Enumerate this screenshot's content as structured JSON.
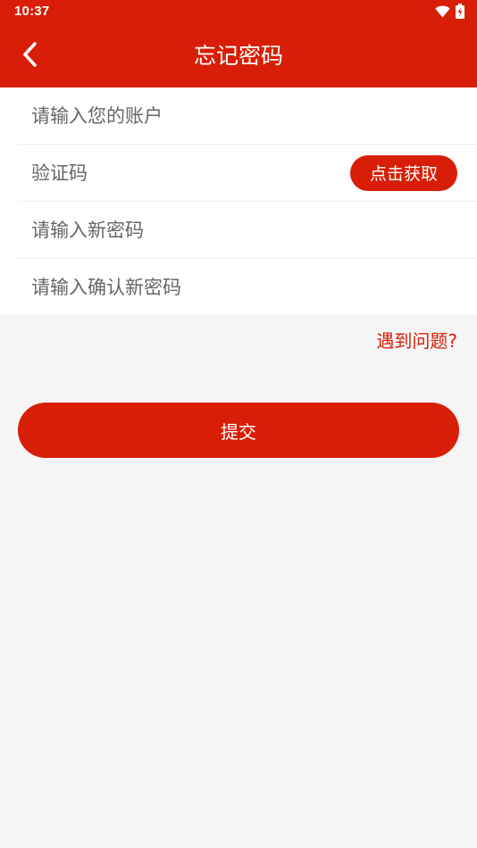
{
  "status_bar": {
    "time": "10:37",
    "icons": [
      "wifi-icon",
      "battery-charging-icon"
    ]
  },
  "app_bar": {
    "title": "忘记密码",
    "back_icon": "chevron-left-icon"
  },
  "form": {
    "account_placeholder": "请输入您的账户",
    "account_value": "",
    "code_placeholder": "验证码",
    "code_value": "",
    "get_code_label": "点击获取",
    "new_password_placeholder": "请输入新密码",
    "new_password_value": "",
    "confirm_password_placeholder": "请输入确认新密码",
    "confirm_password_value": ""
  },
  "help_link": "遇到问题?",
  "submit_label": "提交",
  "colors": {
    "primary": "#d81e06",
    "background": "#f5f5f5",
    "card": "#ffffff",
    "divider": "#eeeeee",
    "placeholder": "#666666"
  }
}
